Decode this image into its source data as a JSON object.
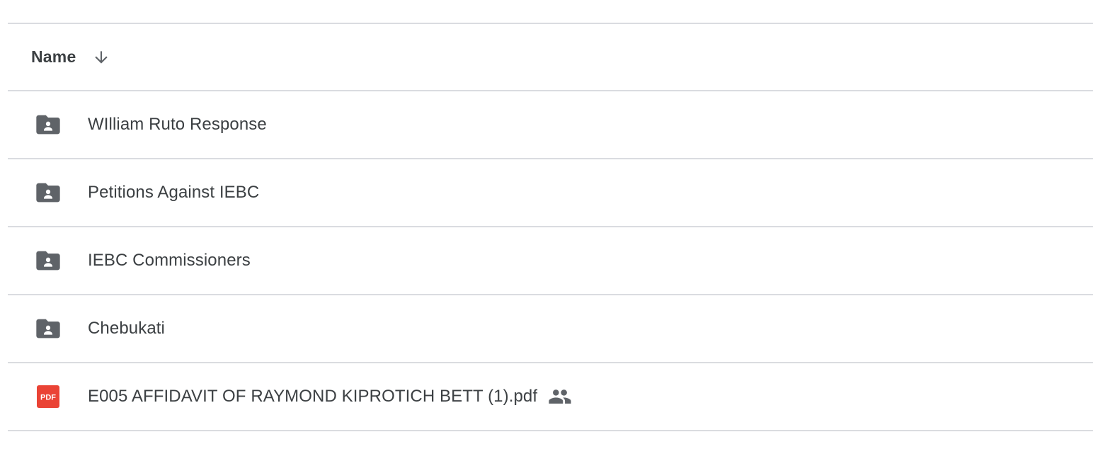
{
  "header": {
    "name_label": "Name",
    "sort_icon": "arrow-down-icon",
    "sort_direction": "descending"
  },
  "files": [
    {
      "name": "WIlliam Ruto Response",
      "type": "shared-folder",
      "icon": "shared-folder-icon"
    },
    {
      "name": "Petitions Against IEBC",
      "type": "shared-folder",
      "icon": "shared-folder-icon"
    },
    {
      "name": "IEBC Commissioners",
      "type": "shared-folder",
      "icon": "shared-folder-icon"
    },
    {
      "name": "Chebukati",
      "type": "shared-folder",
      "icon": "shared-folder-icon"
    },
    {
      "name": "E005 AFFIDAVIT OF RAYMOND KIPROTICH BETT (1).pdf",
      "type": "pdf",
      "icon": "pdf-icon",
      "pdf_badge": "PDF",
      "shared_indicator": "people-icon"
    }
  ],
  "colors": {
    "text": "#3c4043",
    "icon_gray": "#5f6368",
    "divider": "#dadce0",
    "pdf_red": "#ea4335"
  }
}
